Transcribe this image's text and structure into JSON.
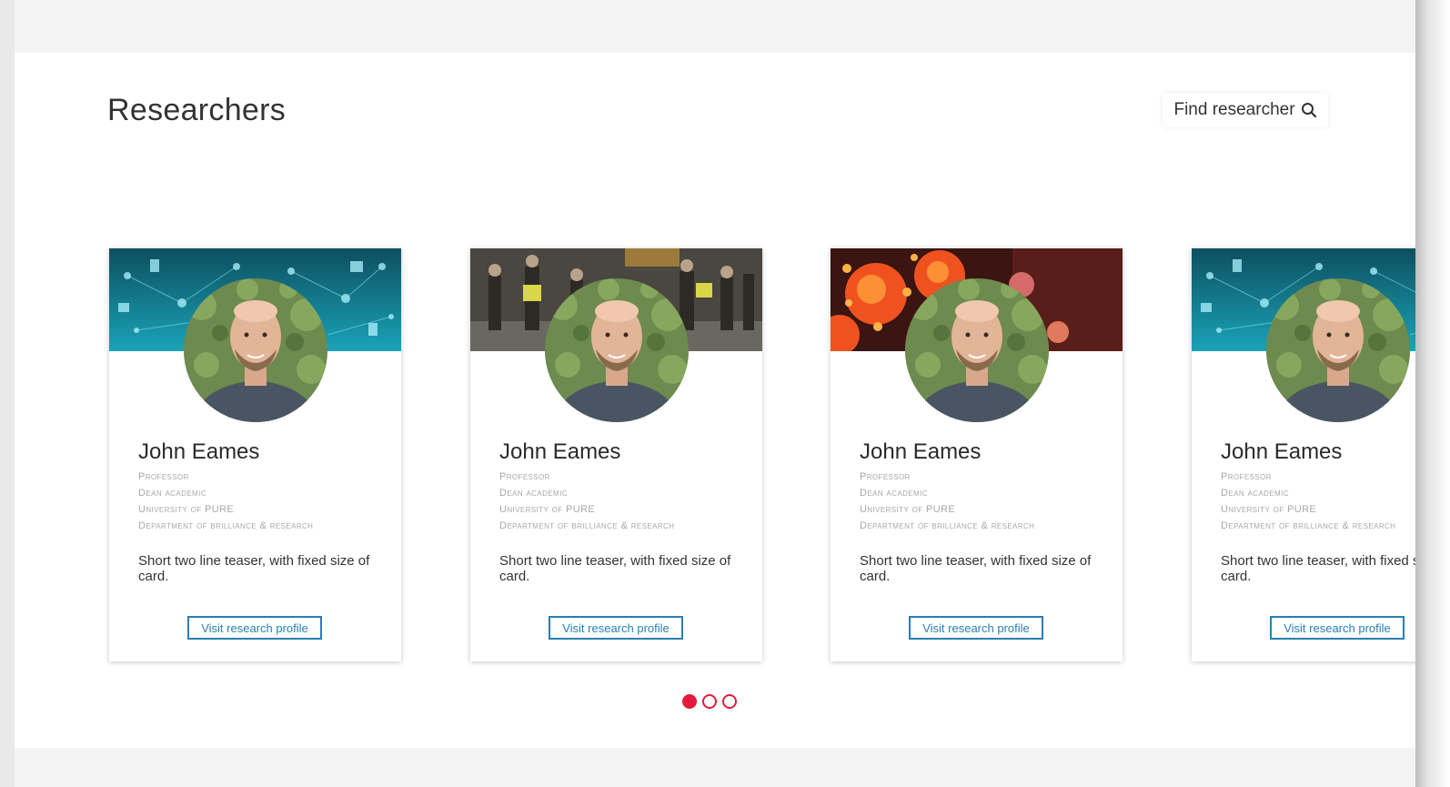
{
  "section": {
    "title": "Researchers",
    "find_button_label": "Find researcher"
  },
  "cards": [
    {
      "name": "John Eames",
      "lines": [
        "Professor",
        "Dean academic",
        "University of PURE",
        "Department of brilliance & research"
      ],
      "teaser": "Short two line teaser, with fixed size of card.",
      "button_label": "Visit research profile",
      "banner": "tech"
    },
    {
      "name": "John Eames",
      "lines": [
        "Professor",
        "Dean academic",
        "University of PURE",
        "Department of brilliance & research"
      ],
      "teaser": "Short two line teaser, with fixed size of card.",
      "button_label": "Visit research profile",
      "banner": "crowd"
    },
    {
      "name": "John Eames",
      "lines": [
        "Professor",
        "Dean academic",
        "University of PURE",
        "Department of brilliance & research"
      ],
      "teaser": "Short two line teaser, with fixed size of card.",
      "button_label": "Visit research profile",
      "banner": "virus"
    },
    {
      "name": "John Eames",
      "lines": [
        "Professor",
        "Dean academic",
        "University of PURE",
        "Department of brilliance & research"
      ],
      "teaser": "Short two line teaser, with fixed size of card.",
      "button_label": "Visit research profile",
      "banner": "tech"
    }
  ],
  "pagination": {
    "pages": 3,
    "active": 1
  },
  "colors": {
    "accent": "#e31c3d",
    "button": "#2a7fb3"
  },
  "icons": {
    "find": "search-icon",
    "avatar": "avatar-photo"
  }
}
